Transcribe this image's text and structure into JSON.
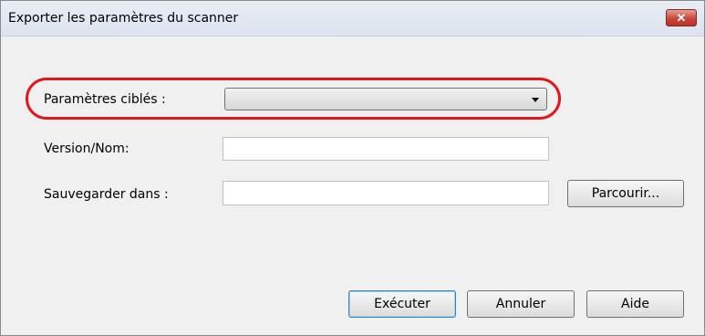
{
  "window": {
    "title": "Exporter les paramètres du scanner",
    "close_glyph": "✕"
  },
  "form": {
    "target_settings": {
      "label": "Paramètres ciblés :",
      "value": ""
    },
    "version_name": {
      "label": "Version/Nom:",
      "value": ""
    },
    "save_in": {
      "label": "Sauvegarder dans :",
      "value": ""
    }
  },
  "buttons": {
    "browse": "Parcourir...",
    "execute": "Exécuter",
    "cancel": "Annuler",
    "help": "Aide"
  },
  "colors": {
    "highlight": "#e3161b",
    "close_button": "#c9463d"
  }
}
